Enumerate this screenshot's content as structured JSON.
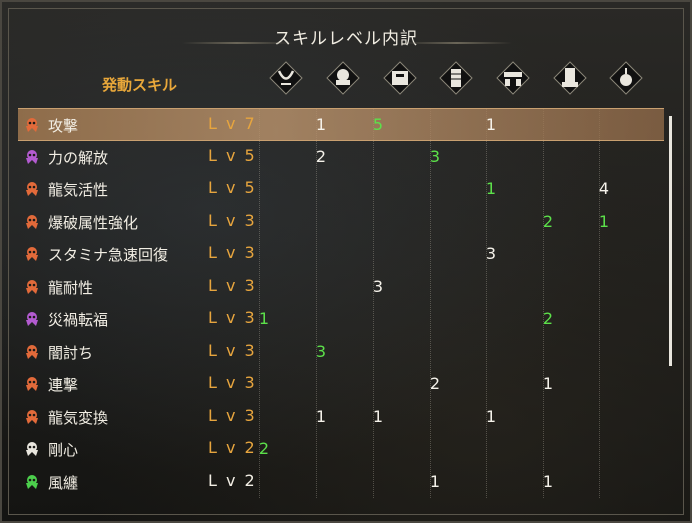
{
  "title": "スキルレベル内訳",
  "header": {
    "active_skills_label": "発動スキル"
  },
  "columns": [
    {
      "icon": "weapon-icon"
    },
    {
      "icon": "helm-icon"
    },
    {
      "icon": "chest-icon"
    },
    {
      "icon": "arms-icon"
    },
    {
      "icon": "waist-icon"
    },
    {
      "icon": "legs-icon"
    },
    {
      "icon": "charm-icon"
    }
  ],
  "colors": {
    "orange": "#e26a3a",
    "purple": "#b35bd0",
    "white": "#e9e6de",
    "green": "#4ccf4c",
    "level": "#e7a53e",
    "value_green": "#5ce04a"
  },
  "skills": [
    {
      "name": "攻撃",
      "level": "Lv7",
      "icon_color": "orange",
      "selected": true,
      "values": [
        "",
        "1",
        "5",
        "",
        "1",
        "",
        ""
      ],
      "green": [
        false,
        false,
        true,
        false,
        false,
        false,
        false
      ]
    },
    {
      "name": "力の解放",
      "level": "Lv5",
      "icon_color": "purple",
      "values": [
        "",
        "2",
        "",
        "3",
        "",
        "",
        ""
      ],
      "green": [
        false,
        false,
        false,
        true,
        false,
        false,
        false
      ]
    },
    {
      "name": "龍気活性",
      "level": "Lv5",
      "icon_color": "orange",
      "values": [
        "",
        "",
        "",
        "",
        "1",
        "",
        "4"
      ],
      "green": [
        false,
        false,
        false,
        false,
        true,
        false,
        false
      ]
    },
    {
      "name": "爆破属性強化",
      "level": "Lv3",
      "icon_color": "orange",
      "values": [
        "",
        "",
        "",
        "",
        "",
        "2",
        "1"
      ],
      "green": [
        false,
        false,
        false,
        false,
        false,
        true,
        true
      ]
    },
    {
      "name": "スタミナ急速回復",
      "level": "Lv3",
      "icon_color": "orange",
      "values": [
        "",
        "",
        "",
        "",
        "3",
        "",
        ""
      ],
      "green": [
        false,
        false,
        false,
        false,
        false,
        false,
        false
      ]
    },
    {
      "name": "龍耐性",
      "level": "Lv3",
      "icon_color": "orange",
      "values": [
        "",
        "",
        "3",
        "",
        "",
        "",
        ""
      ],
      "green": [
        false,
        false,
        false,
        false,
        false,
        false,
        false
      ]
    },
    {
      "name": "災禍転福",
      "level": "Lv3",
      "icon_color": "purple",
      "values": [
        "1",
        "",
        "",
        "",
        "",
        "2",
        ""
      ],
      "green": [
        true,
        false,
        false,
        false,
        false,
        true,
        false
      ]
    },
    {
      "name": "闇討ち",
      "level": "Lv3",
      "icon_color": "orange",
      "values": [
        "",
        "3",
        "",
        "",
        "",
        "",
        ""
      ],
      "green": [
        false,
        true,
        false,
        false,
        false,
        false,
        false
      ]
    },
    {
      "name": "連撃",
      "level": "Lv3",
      "icon_color": "orange",
      "values": [
        "",
        "",
        "",
        "2",
        "",
        "1",
        ""
      ],
      "green": [
        false,
        false,
        false,
        false,
        false,
        false,
        false
      ]
    },
    {
      "name": "龍気変換",
      "level": "Lv3",
      "icon_color": "orange",
      "values": [
        "",
        "1",
        "1",
        "",
        "1",
        "",
        ""
      ],
      "green": [
        false,
        false,
        false,
        false,
        false,
        false,
        false
      ]
    },
    {
      "name": "剛心",
      "level": "Lv2",
      "icon_color": "white",
      "values": [
        "2",
        "",
        "",
        "",
        "",
        "",
        ""
      ],
      "green": [
        true,
        false,
        false,
        false,
        false,
        false,
        false
      ]
    },
    {
      "name": "風纏",
      "level": "Lv2",
      "icon_color": "green",
      "level_white": true,
      "values": [
        "",
        "",
        "",
        "1",
        "",
        "1",
        ""
      ],
      "green": [
        false,
        false,
        false,
        false,
        false,
        false,
        false
      ]
    }
  ]
}
